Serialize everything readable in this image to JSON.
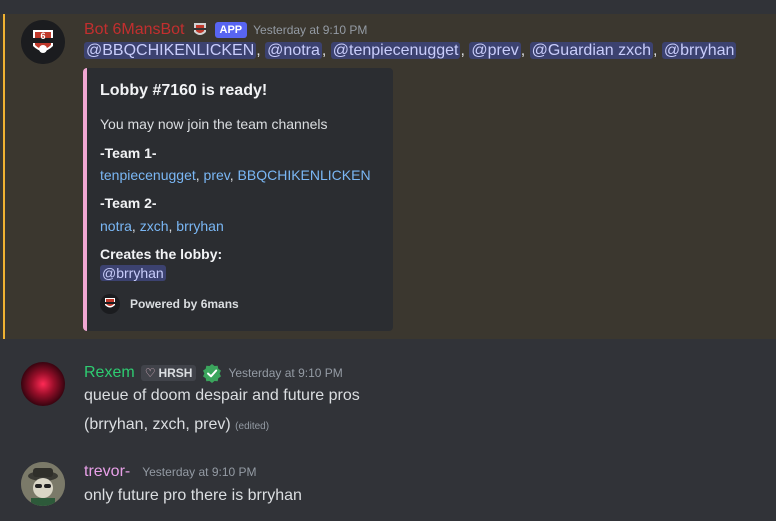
{
  "messages": {
    "bot": {
      "author": "Bot 6MansBot",
      "badge": "APP",
      "timestamp": "Yesterday at 9:10 PM",
      "author_color": "#c22f2f",
      "mentions": [
        "@BBQCHIKENLICKEN",
        "@notra",
        "@tenpiecenugget",
        "@prev",
        "@Guardian zxch",
        "@brryhan"
      ],
      "embed": {
        "title": "Lobby #7160 is ready!",
        "description": "You may now join the team channels",
        "team1_label": "-Team 1-",
        "team1_players": [
          "tenpiecenugget",
          "prev",
          "BBQCHIKENLICKEN"
        ],
        "team2_label": "-Team 2-",
        "team2_players": [
          "notra",
          "zxch",
          "brryhan"
        ],
        "creator_label": "Creates the lobby:",
        "creator_mention": "@brryhan",
        "footer": "Powered by 6mans",
        "accent": "#f1a7d3"
      }
    },
    "rexem": {
      "author": "Rexem",
      "author_color": "#2ecc71",
      "tag": "HRSH",
      "timestamp": "Yesterday at 9:10 PM",
      "lines": [
        "queue of doom despair and future pros",
        "(brryhan, zxch, prev)"
      ],
      "edited": "(edited)"
    },
    "trevor": {
      "author": "trevor-",
      "author_color": "#e8a0e8",
      "timestamp": "Yesterday at 9:10 PM",
      "text": "only future pro there is brryhan"
    }
  }
}
